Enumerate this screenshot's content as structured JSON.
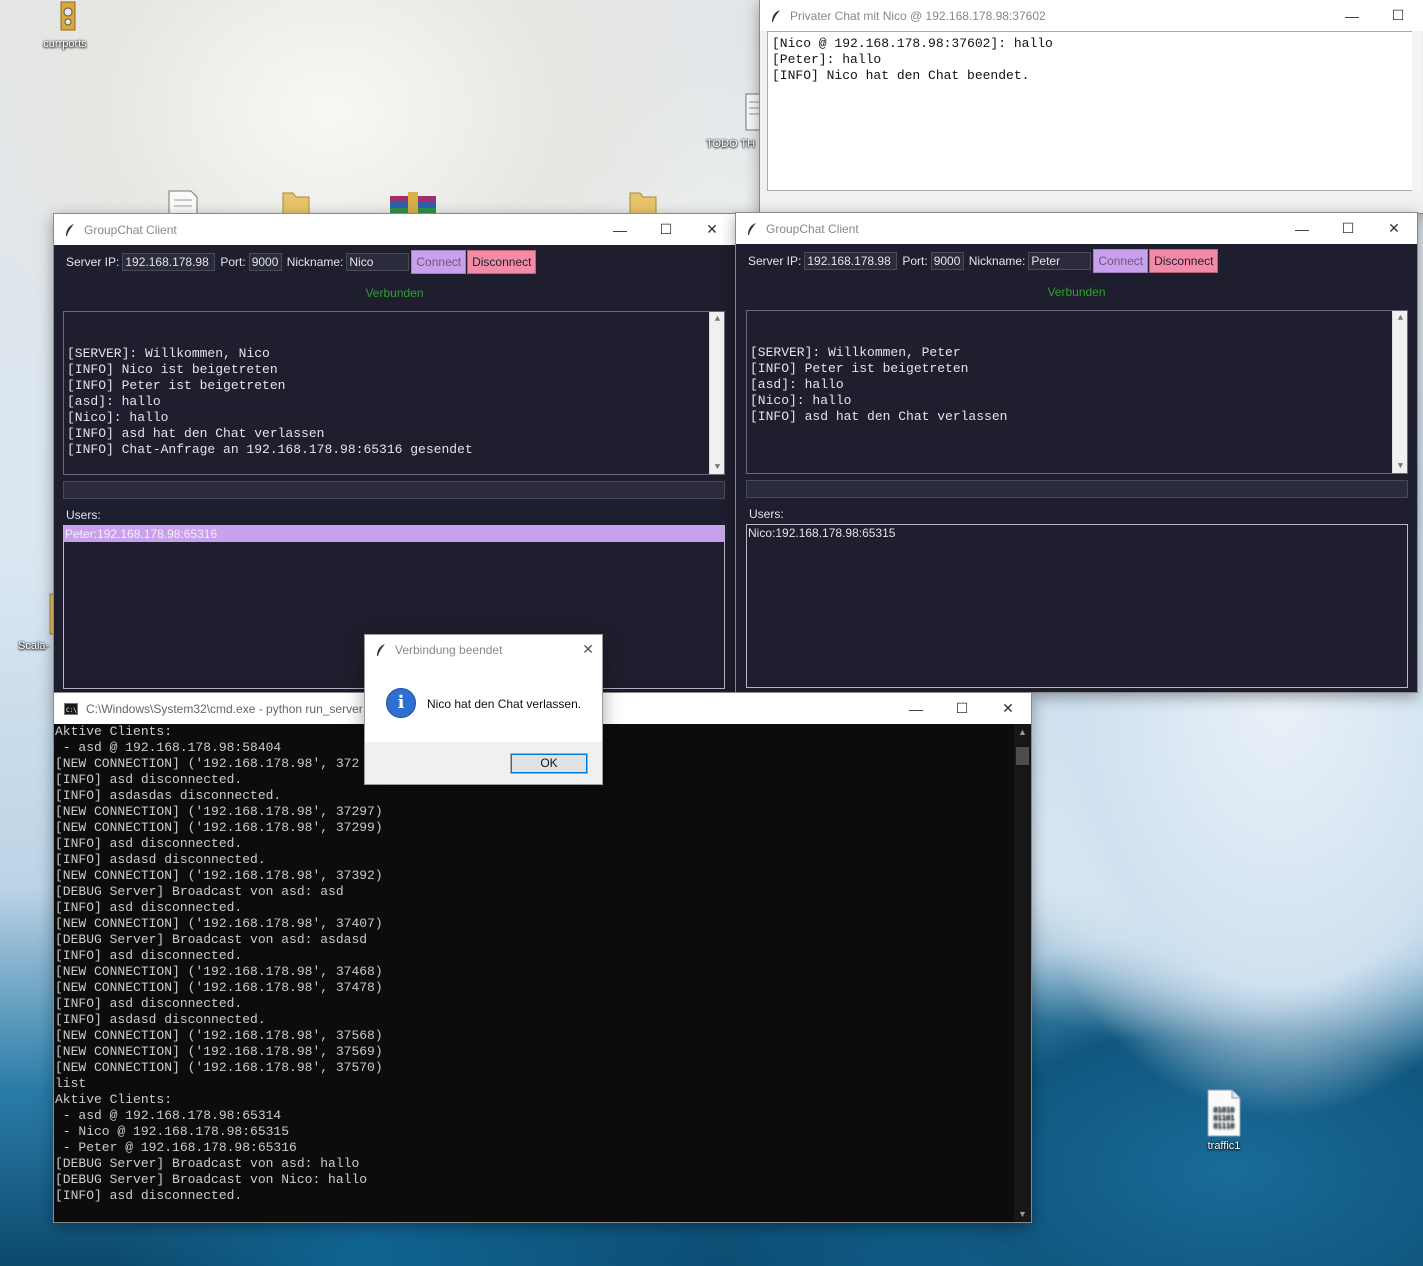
{
  "desktop": {
    "icons": [
      {
        "label": "currports"
      },
      {
        "label": "TODO TH"
      },
      {
        "label": "Scala-"
      },
      {
        "label": "traffic1"
      }
    ]
  },
  "private_chat": {
    "title": "Privater Chat mit Nico @ 192.168.178.98:37602",
    "log": "[Nico @ 192.168.178.98:37602]: hallo\n[Peter]: hallo\n[INFO] Nico hat den Chat beendet."
  },
  "client_nico": {
    "title": "GroupChat Client",
    "server_ip_label": "Server IP:",
    "server_ip_value": "192.168.178.98",
    "port_label": "Port:",
    "port_value": "9000",
    "nickname_label": "Nickname:",
    "nickname_value": "Nico",
    "connect_label": "Connect",
    "disconnect_label": "Disconnect",
    "status": "Verbunden",
    "status_color": "#2fa02f",
    "log": "[SERVER]: Willkommen, Nico\n[INFO] Nico ist beigetreten\n[INFO] Peter ist beigetreten\n[asd]: hallo\n[Nico]: hallo\n[INFO] asd hat den Chat verlassen\n[INFO] Chat-Anfrage an 192.168.178.98:65316 gesendet",
    "users_label": "Users:",
    "users": [
      "Peter:192.168.178.98:65316"
    ],
    "selected_user": "Peter:192.168.178.98:65316"
  },
  "client_peter": {
    "title": "GroupChat Client",
    "server_ip_label": "Server IP:",
    "server_ip_value": "192.168.178.98",
    "port_label": "Port:",
    "port_value": "9000",
    "nickname_label": "Nickname:",
    "nickname_value": "Peter",
    "connect_label": "Connect",
    "disconnect_label": "Disconnect",
    "status": "Verbunden",
    "log": "[SERVER]: Willkommen, Peter\n[INFO] Peter ist beigetreten\n[asd]: hallo\n[Nico]: hallo\n[INFO] asd hat den Chat verlassen",
    "users_label": "Users:",
    "users": [
      "Nico:192.168.178.98:65315"
    ]
  },
  "console": {
    "title": "C:\\Windows\\System32\\cmd.exe - python  run_server",
    "output": "Aktive Clients:\n - asd @ 192.168.178.98:58404\n[NEW CONNECTION] ('192.168.178.98', 372\n[INFO] asd disconnected.\n[INFO] asdasdas disconnected.\n[NEW CONNECTION] ('192.168.178.98', 37297)\n[NEW CONNECTION] ('192.168.178.98', 37299)\n[INFO] asd disconnected.\n[INFO] asdasd disconnected.\n[NEW CONNECTION] ('192.168.178.98', 37392)\n[DEBUG Server] Broadcast von asd: asd\n[INFO] asd disconnected.\n[NEW CONNECTION] ('192.168.178.98', 37407)\n[DEBUG Server] Broadcast von asd: asdasd\n[INFO] asd disconnected.\n[NEW CONNECTION] ('192.168.178.98', 37468)\n[NEW CONNECTION] ('192.168.178.98', 37478)\n[INFO] asd disconnected.\n[INFO] asdasd disconnected.\n[NEW CONNECTION] ('192.168.178.98', 37568)\n[NEW CONNECTION] ('192.168.178.98', 37569)\n[NEW CONNECTION] ('192.168.178.98', 37570)\nlist\nAktive Clients:\n - asd @ 192.168.178.98:65314\n - Nico @ 192.168.178.98:65315\n - Peter @ 192.168.178.98:65316\n[DEBUG Server] Broadcast von asd: hallo\n[DEBUG Server] Broadcast von Nico: hallo\n[INFO] asd disconnected."
  },
  "dialog": {
    "title": "Verbindung beendet",
    "message": "Nico hat den Chat verlassen.",
    "ok_label": "OK",
    "icon": "info-icon"
  },
  "colors": {
    "chat_bg": "#1e1e2e",
    "connect_bg": "#c9a0ee",
    "disconnect_bg": "#f38ba8"
  }
}
